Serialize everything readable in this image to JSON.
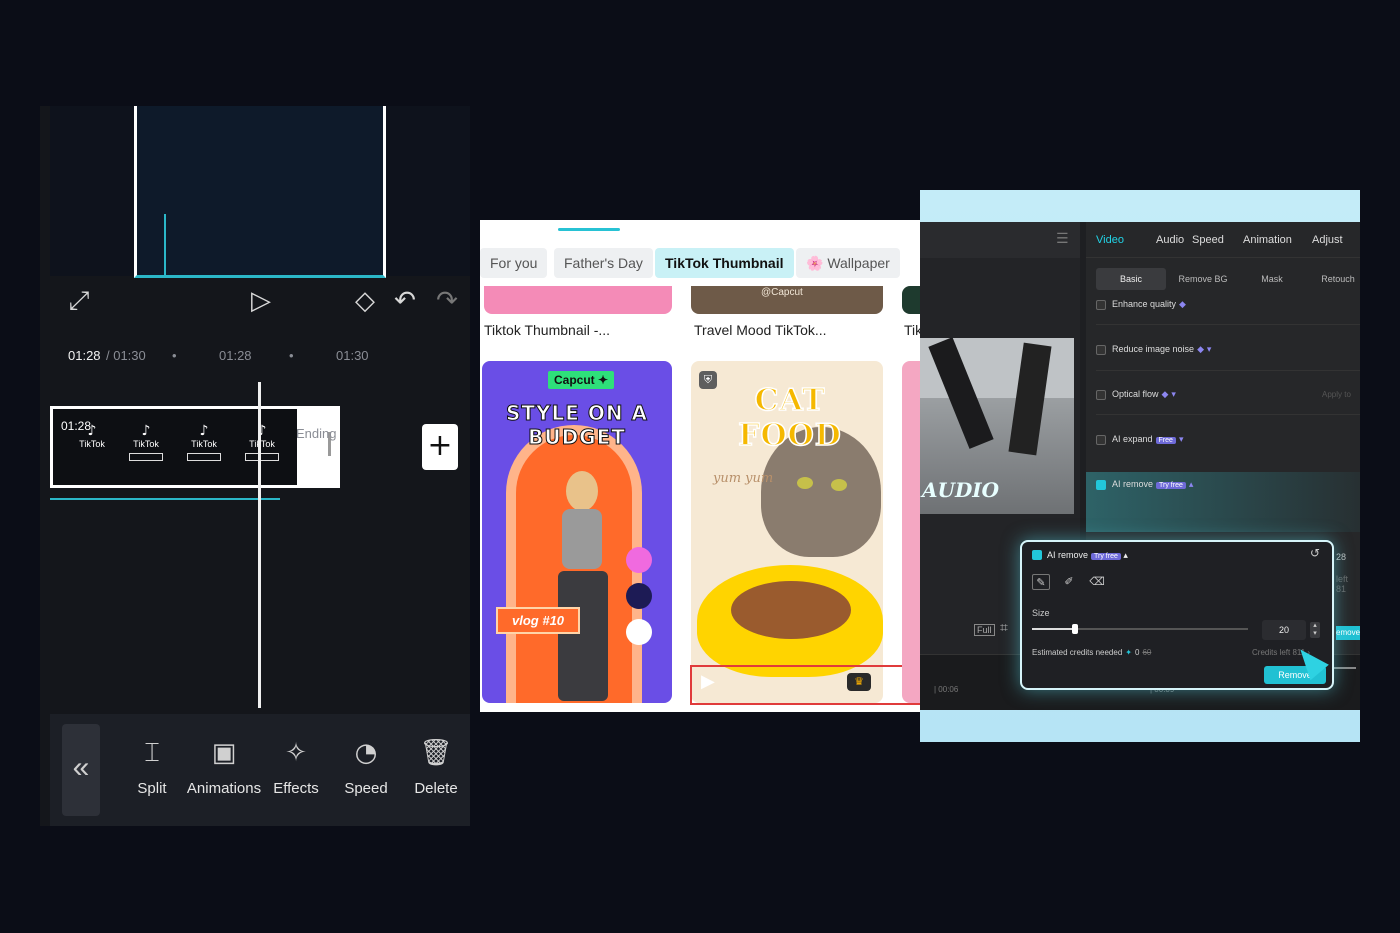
{
  "mobile": {
    "time": {
      "current": "01:28",
      "total": "/ 01:30",
      "mark1": "01:28",
      "mark2": "01:30"
    },
    "clip_time": "01:28",
    "tiktok_label": "TikTok",
    "ending_label": "Ending",
    "add_label": "+",
    "icons": {
      "fullscreen": "⤢",
      "play": "▷",
      "keyframe": "◇",
      "undo": "↶",
      "redo": "↷",
      "collapse": "«"
    },
    "tools": [
      {
        "label": "Split",
        "icon": "⌶"
      },
      {
        "label": "Animations",
        "icon": "▣"
      },
      {
        "label": "Effects",
        "icon": "✧"
      },
      {
        "label": "Speed",
        "icon": "◔"
      },
      {
        "label": "Delete",
        "icon": "🗑"
      }
    ]
  },
  "gallery": {
    "tabs": [
      {
        "label": "For you"
      },
      {
        "label": "Father's Day"
      },
      {
        "label": "TikTok Thumbnail",
        "active": true
      },
      {
        "label": "🌸 Wallpaper"
      }
    ],
    "captions": [
      "Tiktok Thumbnail -...",
      "Travel Mood TikTok...",
      "Tik"
    ],
    "top_card_mark": "@Capcut",
    "card1": {
      "badge": "Capcut ✦",
      "title": "STYLE ON A BUDGET",
      "tag": "vlog #10"
    },
    "card2": {
      "title": "CAT FOOD",
      "subtitle": "yum yum"
    }
  },
  "desktop": {
    "top_tabs": [
      "Video",
      "Audio",
      "Speed",
      "Animation",
      "Adjust"
    ],
    "sub_tabs": [
      "Basic",
      "Remove BG",
      "Mask",
      "Retouch"
    ],
    "options": [
      {
        "label": "Enhance quality",
        "checked": false
      },
      {
        "label": "Reduce image noise",
        "checked": false
      },
      {
        "label": "Optical flow",
        "checked": false
      },
      {
        "label": "AI expand",
        "badge": "Free",
        "checked": false
      },
      {
        "label": "AI remove",
        "badge": "Try free",
        "checked": true
      }
    ],
    "apply_label": "Apply to",
    "video_overlay_text": "AUDIO",
    "full_label": "Full",
    "side_texts": {
      "a": "28",
      "b": "left 81",
      "c": "emove"
    },
    "timeline": {
      "t1": "| 00:06",
      "t2": "| 00:09"
    },
    "popup": {
      "title": "AI remove",
      "badge": "Try free",
      "size_label": "Size",
      "size_value": "20",
      "size_fraction": 0.2,
      "estimated_label": "Estimated credits needed",
      "estimated_value": "0",
      "estimated_old": "60",
      "credits_left": "Credits left 811 ›",
      "remove_button": "Remove"
    }
  }
}
